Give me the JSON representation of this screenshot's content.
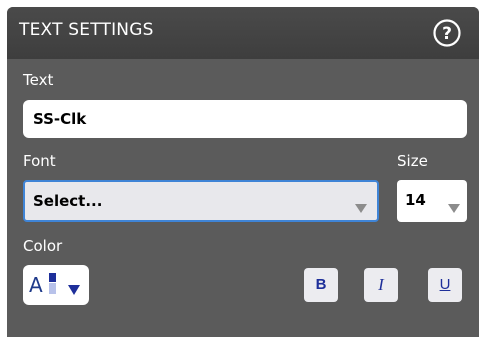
{
  "dialog": {
    "title": "TEXT SETTINGS",
    "help_icon": "help-circle-icon"
  },
  "text_field": {
    "label": "Text",
    "value": "SS-Clk"
  },
  "font_field": {
    "label": "Font",
    "value": "Select..."
  },
  "size_field": {
    "label": "Size",
    "value": "14"
  },
  "color_field": {
    "label": "Color",
    "glyph": "A",
    "swatch_top": "#1e2f9a",
    "swatch_bottom": "#b8c2ea"
  },
  "format_buttons": {
    "bold": "B",
    "italic": "I",
    "underline": "U"
  },
  "colors": {
    "panel_bg": "#5b5b5b",
    "titlebar_bg": "#424242",
    "focus_border": "#3f84d6",
    "accent_text": "#1e2f9a"
  }
}
